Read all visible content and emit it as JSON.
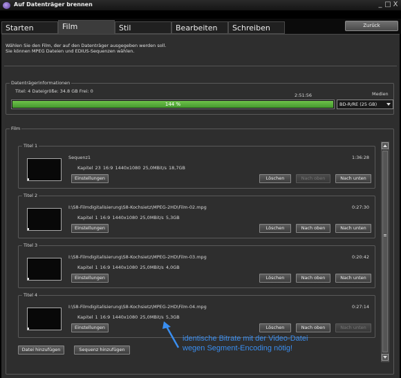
{
  "window": {
    "title": "Auf Datenträger brennen",
    "controls": [
      "_",
      "□",
      "X"
    ]
  },
  "tabs": [
    {
      "label": "Starten"
    },
    {
      "label": "Film"
    },
    {
      "label": "Stil"
    },
    {
      "label": "Bearbeiten"
    },
    {
      "label": "Schreiben"
    }
  ],
  "active_tab": "Film",
  "back_label": "Zurück",
  "description": {
    "line1": "Wählen Sie den Film, der auf den Datenträger ausgegeben werden soll.",
    "line2": "Sie können MPEG Dateien und EDIUS-Sequenzen wählen."
  },
  "disc_info": {
    "legend": "Datenträgerinformationen",
    "summary": "Titel: 4   Dateigröße: 34.8 GB  Frei: 0",
    "duration": "2:51:56",
    "media_label": "Medien",
    "fill_percent": 100,
    "fill_label": "144 %",
    "media_value": "BD-R/RE (25 GB)"
  },
  "film": {
    "legend": "Film",
    "titles": [
      {
        "legend": "Titel 1",
        "name": "Sequenz1",
        "duration": "1:36:28",
        "specs": "Kapitel 23   16:9   1440x1080   25,0MBit/s   18,7GB",
        "up_enabled": false,
        "down_enabled": true
      },
      {
        "legend": "Titel 2",
        "name": "I:\\S8-Filmdigitalisierung\\S8-Kochsietz\\MPEG-2HD\\Film-02.mpg",
        "duration": "0:27:30",
        "specs": "Kapitel 1   16:9   1440x1080   25,0MBit/s   5,3GB",
        "up_enabled": true,
        "down_enabled": true
      },
      {
        "legend": "Titel 3",
        "name": "I:\\S8-Filmdigitalisierung\\S8-Kochsietz\\MPEG-2HD\\Film-03.mpg",
        "duration": "0:20:42",
        "specs": "Kapitel 1   16:9   1440x1080   25,0MBit/s   4,0GB",
        "up_enabled": true,
        "down_enabled": true
      },
      {
        "legend": "Titel 4",
        "name": "I:\\S8-Filmdigitalisierung\\S8-Kochsietz\\MPEG-2HD\\Film-04.mpg",
        "duration": "0:27:14",
        "specs": "Kapitel 1   16:9   1440x1080   25,0MBit/s   5,3GB",
        "up_enabled": true,
        "down_enabled": false
      }
    ],
    "btn_settings": "Einstellungen",
    "btn_delete": "Löschen",
    "btn_up": "Nach oben",
    "btn_down": "Nach unten",
    "add_file": "Datei hinzufügen",
    "add_sequence": "Sequenz hinzufügen"
  },
  "annotation": {
    "text": "identische Bitrate mit der Video-Datei wegen Segment-Encoding nötig!",
    "color": "#3a8ef0"
  },
  "colors": {
    "capacity_fill": "#5ab23c",
    "accent": "#3a8ef0"
  }
}
